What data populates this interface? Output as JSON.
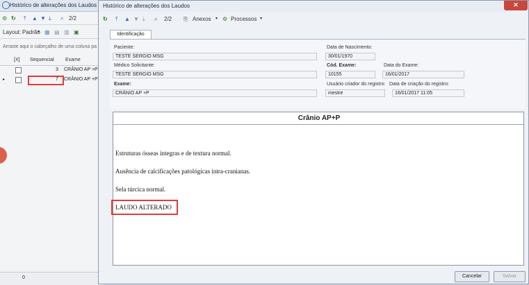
{
  "background_window": {
    "title": "Histórico de alterações dos Laudos",
    "toolbar1": {
      "pages": "2/2"
    },
    "toolbar2": {
      "layout_label": "Layout:",
      "layout_value": "Padrão"
    },
    "group_hint": "Arraste aqui o cabeçalho de uma coluna pa",
    "columns": [
      "[X]",
      "Sequencial",
      "Exame"
    ],
    "rows": [
      {
        "sequencial": "3",
        "exame": "CRÂNIO AP +P"
      },
      {
        "sequencial": "7",
        "exame": "CRÂNIO AP +P"
      }
    ],
    "footer_value": "0"
  },
  "dialog": {
    "title": "Histórico de alterações dos Laudos",
    "close_label": "✕",
    "toolbar": {
      "pages": "2/2",
      "anexos": "Anexos",
      "processos": "Processos"
    },
    "tab": "Identificação",
    "fields": {
      "paciente_label": "Paciente:",
      "paciente": "TESTE SERGIO MSG",
      "nascimento_label": "Data de Nascimento:",
      "nascimento": "30/01/1970",
      "medico_label": "Médico Solicitante:",
      "medico": "TESTE SERGIO MSG",
      "cod_exame_label": "Cód. Exame:",
      "cod_exame": "10155",
      "data_exame_label": "Data do Exame:",
      "data_exame": "16/01/2017",
      "exame_label": "Exame:",
      "exame": "CRÂNIO AP +P",
      "usuario_label": "Usuário criador do registro:",
      "usuario": "mestre",
      "criacao_label": "Data de criação do registro:",
      "criacao": "16/01/2017 11:05"
    },
    "document": {
      "title": "Crânio AP+P",
      "paragraphs": [
        "Estruturas ósseas íntegras e de textura normal.",
        "Ausência de calcificações patológicas intra-cranianas.",
        "Sela túrcica normal.",
        "LAUDO ALTERADO"
      ]
    },
    "buttons": {
      "cancel": "Cancelar",
      "save": "Salvar"
    }
  }
}
